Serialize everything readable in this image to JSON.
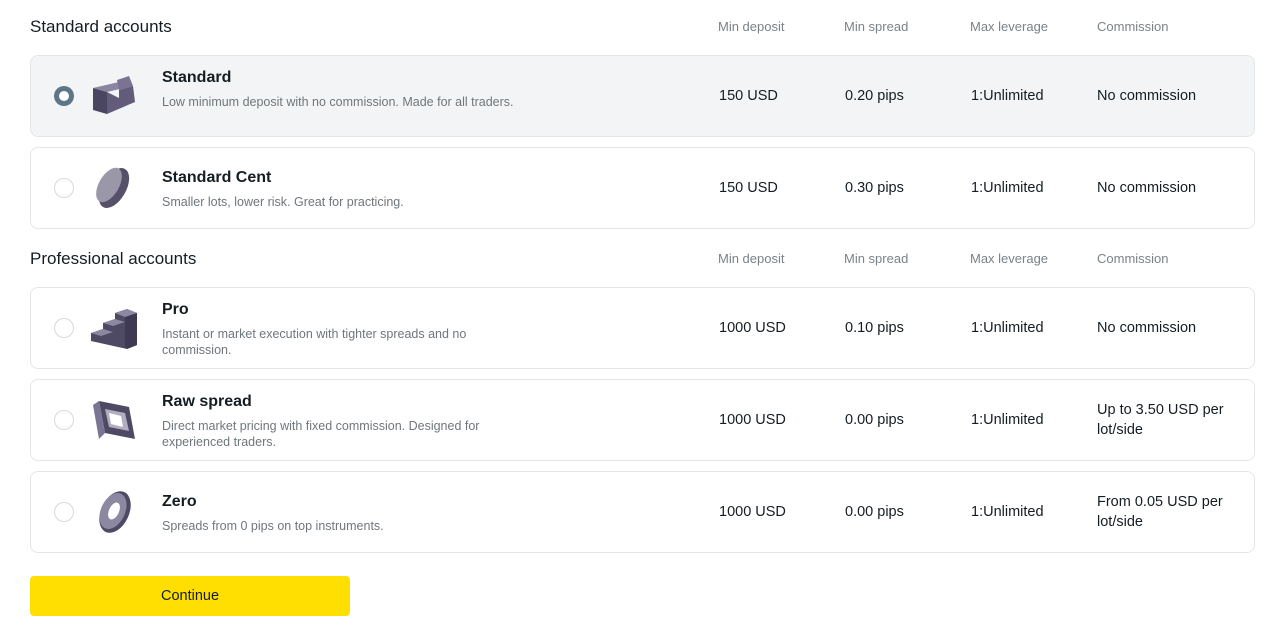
{
  "standard_section": {
    "title": "Standard accounts",
    "columns": [
      "Min deposit",
      "Min spread",
      "Max leverage",
      "Commission"
    ]
  },
  "professional_section": {
    "title": "Professional accounts",
    "columns": [
      "Min deposit",
      "Min spread",
      "Max leverage",
      "Commission"
    ]
  },
  "accounts": [
    {
      "name": "Standard",
      "description": "Low minimum deposit with no commission. Made for all traders.",
      "min_deposit": "150 USD",
      "min_spread": "0.20 pips",
      "max_leverage": "1:Unlimited",
      "commission": "No commission",
      "selected": true,
      "icon": "wedge-icon"
    },
    {
      "name": "Standard Cent",
      "description": "Smaller lots, lower risk. Great for practicing.",
      "min_deposit": "150 USD",
      "min_spread": "0.30 pips",
      "max_leverage": "1:Unlimited",
      "commission": "No commission",
      "selected": false,
      "icon": "coin-icon"
    },
    {
      "name": "Pro",
      "description": "Instant or market execution with tighter spreads and no commission.",
      "min_deposit": "1000 USD",
      "min_spread": "0.10 pips",
      "max_leverage": "1:Unlimited",
      "commission": "No commission",
      "selected": false,
      "icon": "stairs-icon"
    },
    {
      "name": "Raw spread",
      "description": "Direct market pricing with fixed commission. Designed for experienced traders.",
      "min_deposit": "1000 USD",
      "min_spread": "0.00 pips",
      "max_leverage": "1:Unlimited",
      "commission": "Up to 3.50 USD per lot/side",
      "selected": false,
      "icon": "square-frame-icon"
    },
    {
      "name": "Zero",
      "description": "Spreads from 0 pips on top instruments.",
      "min_deposit": "1000 USD",
      "min_spread": "0.00 pips",
      "max_leverage": "1:Unlimited",
      "commission": "From 0.05 USD per lot/side",
      "selected": false,
      "icon": "ring-icon"
    }
  ],
  "continue_label": "Continue",
  "colors": {
    "accent": "#ffde02",
    "radio_selected": "#5e7786",
    "icon": "#565068",
    "text": "#141d22",
    "muted": "#7b8388"
  }
}
